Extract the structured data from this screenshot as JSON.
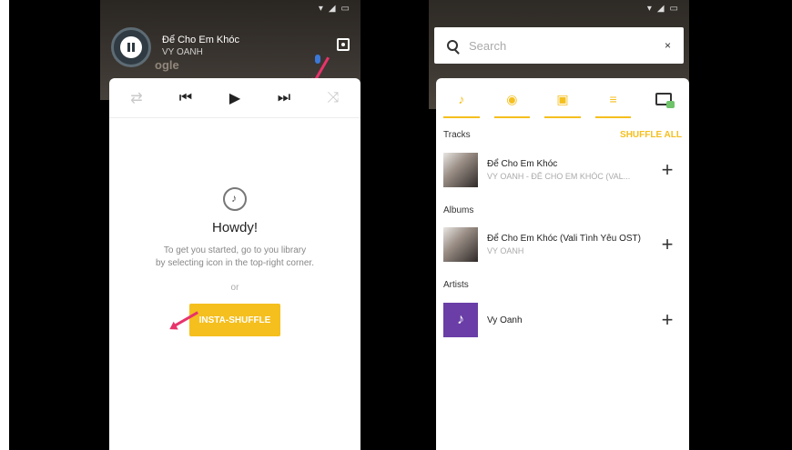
{
  "left_phone": {
    "now_playing": {
      "title": "Để Cho Em Khóc",
      "artist": "VY OANH",
      "pause_icon": "pause-icon",
      "library_icon": "library-icon"
    },
    "controls": [
      "repeat-icon",
      "skip-previous-icon",
      "play-icon",
      "skip-next-icon",
      "shuffle-icon"
    ],
    "empty_state": {
      "heading": "Howdy!",
      "hint_line1": "To get you started, go to you library",
      "hint_line2": "by selecting  icon in the top-right corner.",
      "or": "or",
      "button_label": "INSTA-SHUFFLE"
    }
  },
  "right_phone": {
    "search": {
      "placeholder": "Search",
      "close": "×"
    },
    "tabs": [
      "note-icon",
      "disc-icon",
      "artist-card-icon",
      "playlist-icon",
      "radio-icon"
    ],
    "tracks": {
      "header": "Tracks",
      "shuffle_all": "SHUFFLE ALL",
      "items": [
        {
          "title": "Để Cho Em Khóc",
          "subtitle": "VY OANH - ĐỂ CHO EM KHÓC (VAL..."
        }
      ]
    },
    "albums": {
      "header": "Albums",
      "items": [
        {
          "title": "Để Cho Em Khóc (Vali Tình Yêu OST)",
          "subtitle": "VY OANH"
        }
      ]
    },
    "artists": {
      "header": "Artists",
      "items": [
        {
          "title": "Vy Oanh"
        }
      ]
    }
  },
  "colors": {
    "accent": "#f5bf1e",
    "arrow": "#e8336b",
    "artist_tile": "#6a3ea6"
  }
}
